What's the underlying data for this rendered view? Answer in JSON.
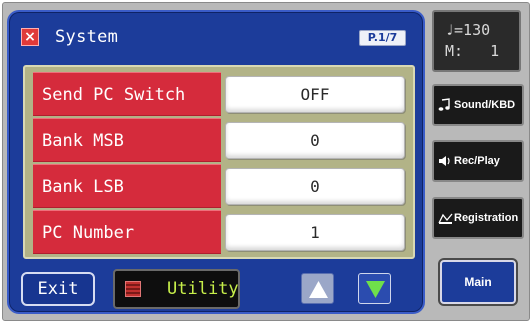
{
  "dialog": {
    "close_glyph": "×",
    "title": "System",
    "page": "P.1/7"
  },
  "rows": [
    {
      "label": "Send PC Switch",
      "value": "OFF"
    },
    {
      "label": "Bank MSB",
      "value": "0"
    },
    {
      "label": "Bank LSB",
      "value": "0"
    },
    {
      "label": "PC Number",
      "value": "1"
    }
  ],
  "footer": {
    "exit_label": "Exit",
    "utility_label": "Utility",
    "up_icon": "triangle-up-icon",
    "down_icon": "triangle-down-icon"
  },
  "status": {
    "tempo": "♩=130",
    "measure": "M:   1"
  },
  "side_buttons": {
    "sound_kbd": "Sound/KBD",
    "rec_play": "Rec/Play",
    "registration": "Registration",
    "main": "Main"
  },
  "colors": {
    "dialog_blue": "#1c3c9a",
    "label_red": "#d52b3c",
    "panel_olive": "#b2b387",
    "utility_text": "#c7ef4a"
  }
}
